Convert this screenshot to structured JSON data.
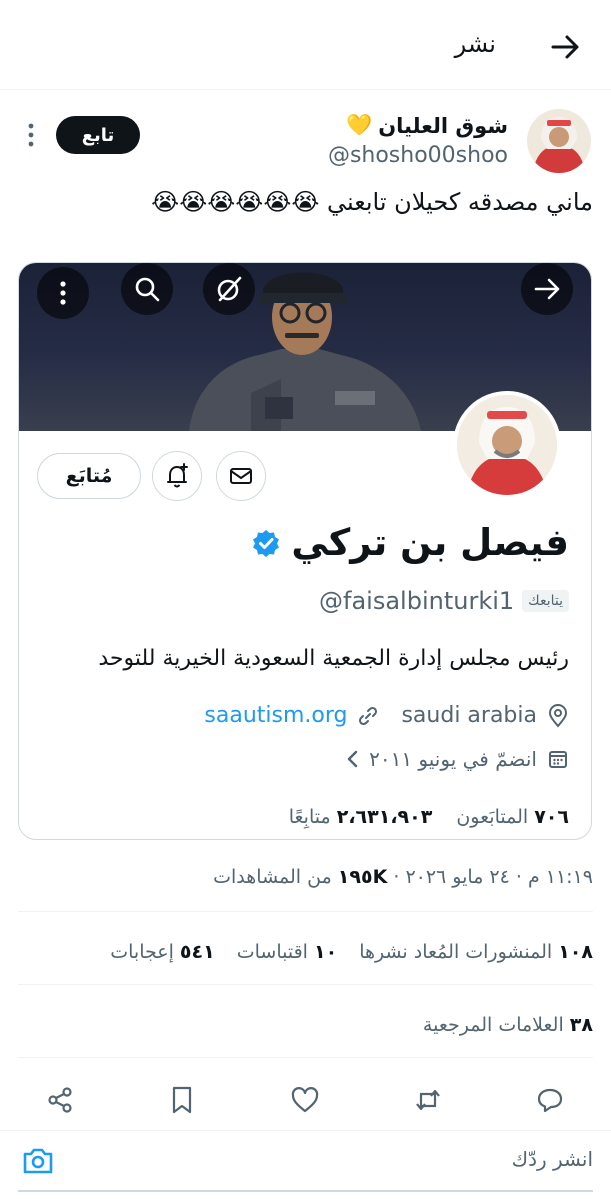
{
  "header": {
    "title": "نشر"
  },
  "author": {
    "name": "شوق العليان",
    "emoji": "💛",
    "handle": "@shosho00shoo",
    "follow_label": "تابع"
  },
  "tweet": {
    "text": "ماني مصدقه كحيلان تابعني 😭😭😭😭😭😭"
  },
  "embedded_profile": {
    "following_label": "مُتابَع",
    "name": "فيصل بن تركي",
    "handle": "@faisalbinturki1",
    "follows_you_label": "يتابعك",
    "bio": "رئيس مجلس إدارة الجمعية السعودية الخيرية للتوحد",
    "location": "saudi arabia",
    "website": "saautism.org",
    "joined": "انضمّ في يونيو ٢٠١١",
    "following_count": "٧٠٦",
    "following_label_text": "المتابَعون",
    "followers_count": "٢،٦٣١،٩٠٣",
    "followers_label_text": "متابِعًا"
  },
  "meta": {
    "time": "١١:١٩ م · ٢٤ مايو ٢٠٢٦ · ",
    "views_count": "١٩٥K",
    "views_label": " من المشاهدات"
  },
  "stats": {
    "reposts_count": "١٠٨",
    "reposts_label": "المنشورات المُعاد نشرها",
    "quotes_count": "١٠",
    "quotes_label": "اقتباسات",
    "likes_count": "٥٤١",
    "likes_label": "إعجابات",
    "bookmarks_count": "٣٨",
    "bookmarks_label": "العلامات المرجعية"
  },
  "reply": {
    "placeholder": "انشر ردّك"
  },
  "colors": {
    "accent": "#1d9bf0",
    "text": "#0f1419",
    "muted": "#536471",
    "border": "#cfd9de"
  }
}
